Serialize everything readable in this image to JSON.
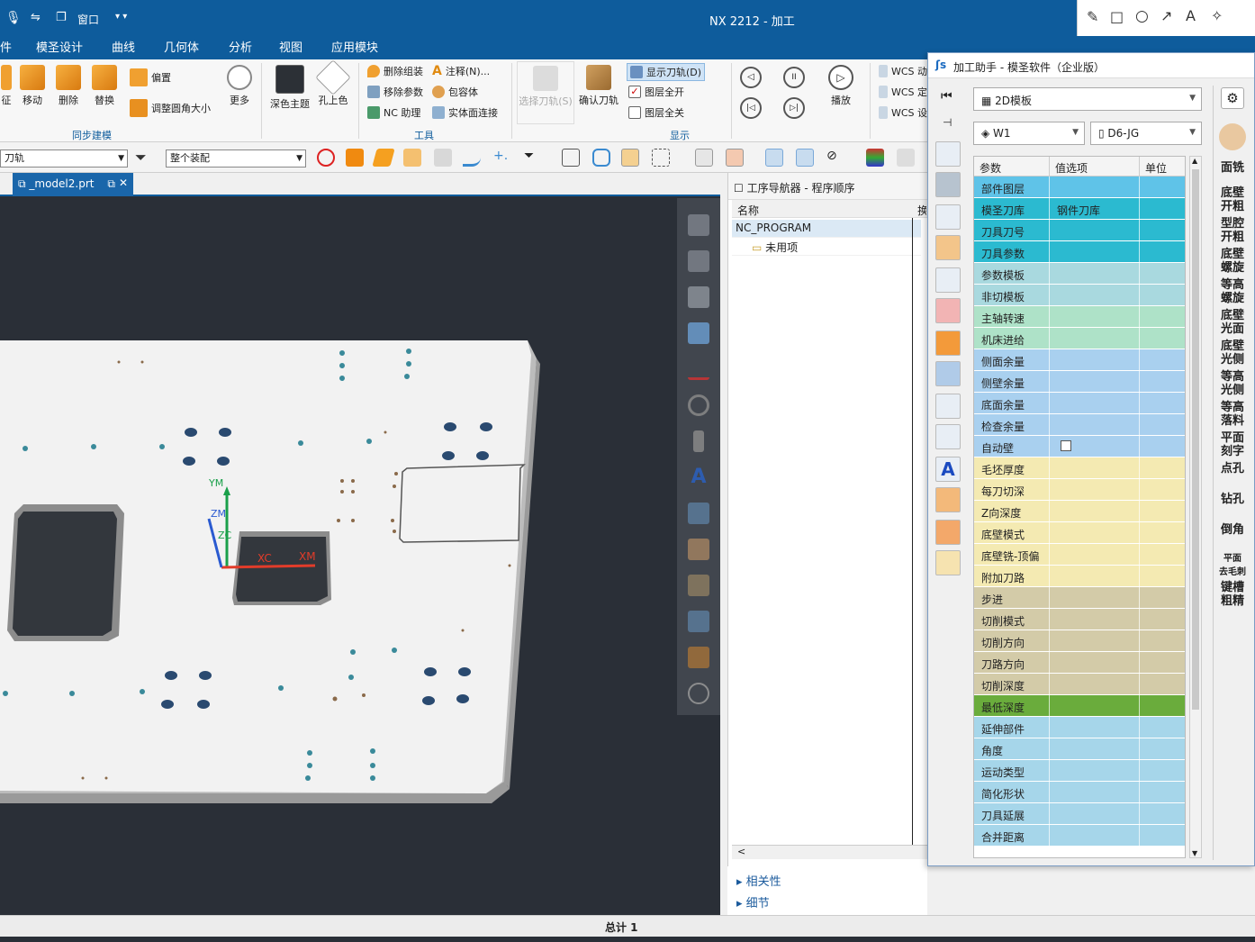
{
  "titlebar": {
    "title": "NX 2212 - 加工",
    "window_menu": "窗口"
  },
  "menu": [
    "件",
    "模圣设计",
    "曲线",
    "几何体",
    "分析",
    "视图",
    "应用模块"
  ],
  "ribbon": {
    "sync_buttons": [
      "征",
      "移动",
      "删除",
      "替换"
    ],
    "offset": "偏置",
    "adjust_fillet": "调整圆角大小",
    "more": "更多",
    "sync_group": "同步建模",
    "dark_theme": "深色主题",
    "hole_color": "孔上色",
    "delete_asm": "删除组装",
    "remove_param": "移除参数",
    "nc_helper": "NC 助理",
    "annotation": "注释(N)...",
    "bounding": "包容体",
    "solid_face": "实体面连接",
    "tools_group": "工具",
    "select_tool": "选择刀轨(S)",
    "confirm_tool": "确认刀轨",
    "show_path": "显示刀轨(D)",
    "layer_on": "图层全开",
    "layer_off": "图层全关",
    "display_group": "显示",
    "play": "播放",
    "wcs1": "WCS 动",
    "wcs2": "WCS 定",
    "wcs3": "WCS 设"
  },
  "toolbar2": {
    "filter": "刀轨",
    "scope": "整个装配"
  },
  "tab": {
    "file": "_model2.prt"
  },
  "model": {
    "labels": [
      "YM",
      "ZM",
      "ZC",
      "XC",
      "XM"
    ]
  },
  "navigator": {
    "title": "工序导航器 - 程序顺序",
    "col_name": "名称",
    "col_other": "换",
    "rows": [
      "NC_PROGRAM",
      "未用项"
    ],
    "sections": [
      "相关性",
      "细节"
    ]
  },
  "status": {
    "total": "总计 1"
  },
  "assistant": {
    "title": "加工助手 - 模圣软件（企业版）",
    "template": "2D模板",
    "workpiece": "W1",
    "tool": "D6-JG",
    "headers": [
      "参数",
      "值选项",
      "单位"
    ],
    "rows": [
      {
        "p": "部件图层",
        "v": "",
        "c": "#5fc3e8"
      },
      {
        "p": "模圣刀库",
        "v": "钢件刀库",
        "c": "#2bbad0"
      },
      {
        "p": "刀具刀号",
        "v": "",
        "c": "#2bbad0"
      },
      {
        "p": "刀具参数",
        "v": "",
        "c": "#2bbad0"
      },
      {
        "p": "参数模板",
        "v": "",
        "c": "#a9d9df"
      },
      {
        "p": "非切模板",
        "v": "",
        "c": "#a9d9df"
      },
      {
        "p": "主轴转速",
        "v": "",
        "c": "#aee2c8"
      },
      {
        "p": "机床进给",
        "v": "",
        "c": "#aee2c8"
      },
      {
        "p": "侧面余量",
        "v": "",
        "c": "#a9d0ef"
      },
      {
        "p": "侧壁余量",
        "v": "",
        "c": "#a9d0ef"
      },
      {
        "p": "底面余量",
        "v": "",
        "c": "#a9d0ef"
      },
      {
        "p": "检查余量",
        "v": "",
        "c": "#a9d0ef"
      },
      {
        "p": "自动壁",
        "v": "checkbox",
        "c": "#a9d0ef"
      },
      {
        "p": "毛坯厚度",
        "v": "",
        "c": "#f4eab2"
      },
      {
        "p": "每刀切深",
        "v": "",
        "c": "#f4eab2"
      },
      {
        "p": "Z向深度",
        "v": "",
        "c": "#f4eab2"
      },
      {
        "p": "底壁模式",
        "v": "",
        "c": "#f4eab2"
      },
      {
        "p": "底壁铣-顶偏",
        "v": "",
        "c": "#f4eab2"
      },
      {
        "p": "附加刀路",
        "v": "",
        "c": "#f4eab2"
      },
      {
        "p": "步进",
        "v": "",
        "c": "#d3cba8"
      },
      {
        "p": "切削模式",
        "v": "",
        "c": "#d3cba8"
      },
      {
        "p": "切削方向",
        "v": "",
        "c": "#d3cba8"
      },
      {
        "p": "刀路方向",
        "v": "",
        "c": "#d3cba8"
      },
      {
        "p": "切削深度",
        "v": "",
        "c": "#d3cba8"
      },
      {
        "p": "最低深度",
        "v": "",
        "c": "#6aac3c"
      },
      {
        "p": "延伸部件",
        "v": "",
        "c": "#a6d6ea"
      },
      {
        "p": "角度",
        "v": "",
        "c": "#a6d6ea"
      },
      {
        "p": "运动类型",
        "v": "",
        "c": "#a6d6ea"
      },
      {
        "p": "简化形状",
        "v": "",
        "c": "#a6d6ea"
      },
      {
        "p": "刀具延展",
        "v": "",
        "c": "#a6d6ea"
      },
      {
        "p": "合并距离",
        "v": "",
        "c": "#a6d6ea"
      }
    ],
    "right_ops": [
      "面铣",
      "底壁开粗",
      "型腔开粗",
      "底壁螺旋",
      "等高螺旋",
      "底壁光面",
      "底壁光侧",
      "等高光侧",
      "等高落料",
      "平面刻字",
      "点孔",
      "钻孔",
      "倒角",
      "平面去毛刺",
      "键槽粗精"
    ]
  },
  "colors": {
    "brand": "#0e5c9c",
    "viewport": "#2a2f37",
    "part": "#f2f2f2"
  }
}
